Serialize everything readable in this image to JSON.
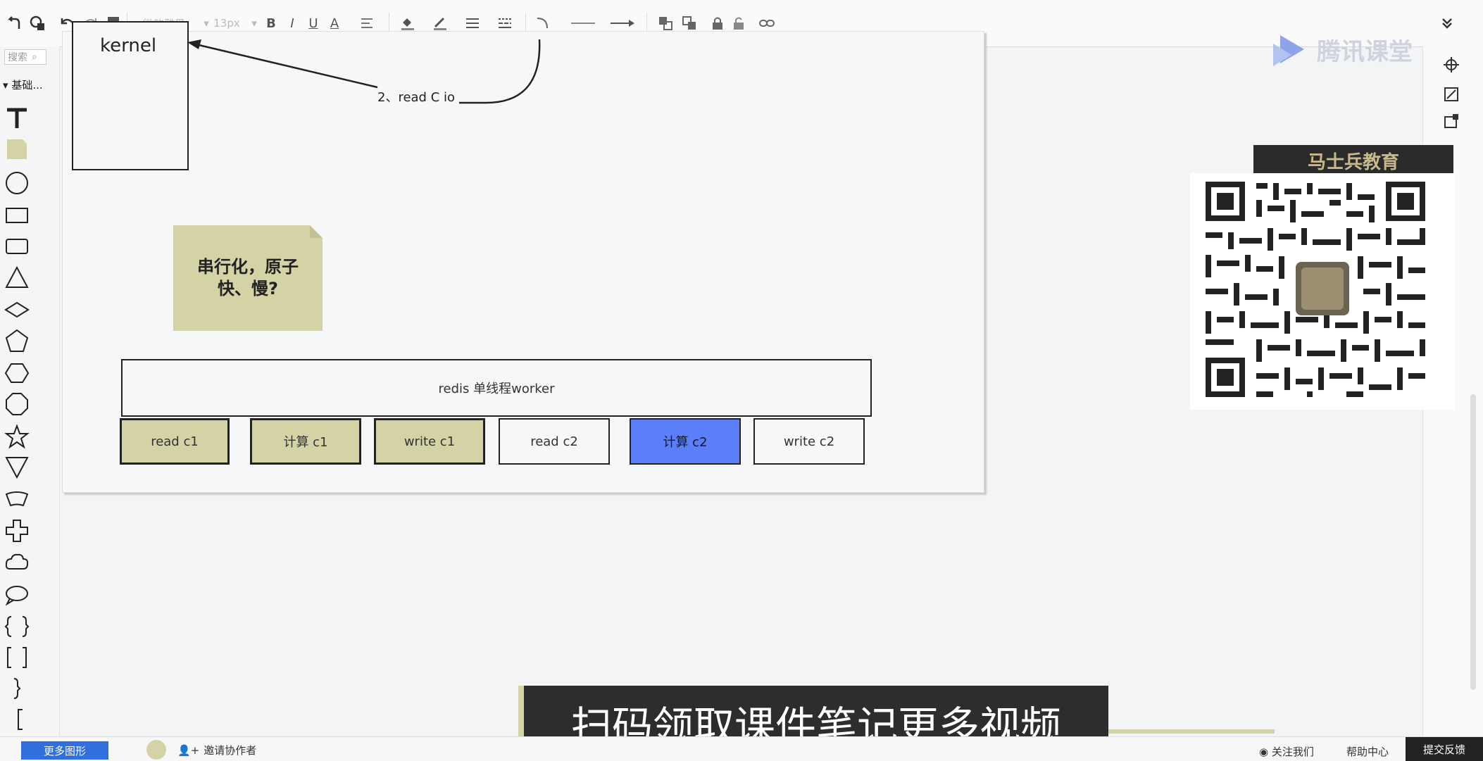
{
  "toolbar": {
    "font_family": "微软雅黑",
    "font_size": "13px",
    "bold": "B",
    "italic": "I",
    "underline": "U",
    "font_color": "A",
    "collapse_icon": "double-chevron-down-icon"
  },
  "left_panel": {
    "search_placeholder": "搜索",
    "category_label": "基础..."
  },
  "canvas": {
    "kernel_label": "kernel",
    "edge_label": "2、read C io",
    "note_line1": "串行化，原子",
    "note_line2": "快、慢?",
    "worker_label": "redis  单线程worker",
    "tasks": [
      {
        "label": "read c1",
        "style": "tan"
      },
      {
        "label": "计算 c1",
        "style": "tan"
      },
      {
        "label": "write c1",
        "style": "tan"
      },
      {
        "label": "read c2",
        "style": "white"
      },
      {
        "label": "计算 c2",
        "style": "blue"
      },
      {
        "label": "write c2",
        "style": "white"
      }
    ]
  },
  "overlay": {
    "logo_text": "腾讯课堂",
    "promo_label": "马士兵教育",
    "subtitle": "扫码领取课件笔记更多视频"
  },
  "bottombar": {
    "more_shapes": "更多图形",
    "invite": "邀请协作者",
    "follow": "关注我们",
    "help": "帮助中心",
    "feedback": "提交反馈"
  },
  "colors": {
    "tan": "#d4d3a5",
    "blue": "#5b7ff9",
    "canvas_bg": "#f6f7f9"
  }
}
